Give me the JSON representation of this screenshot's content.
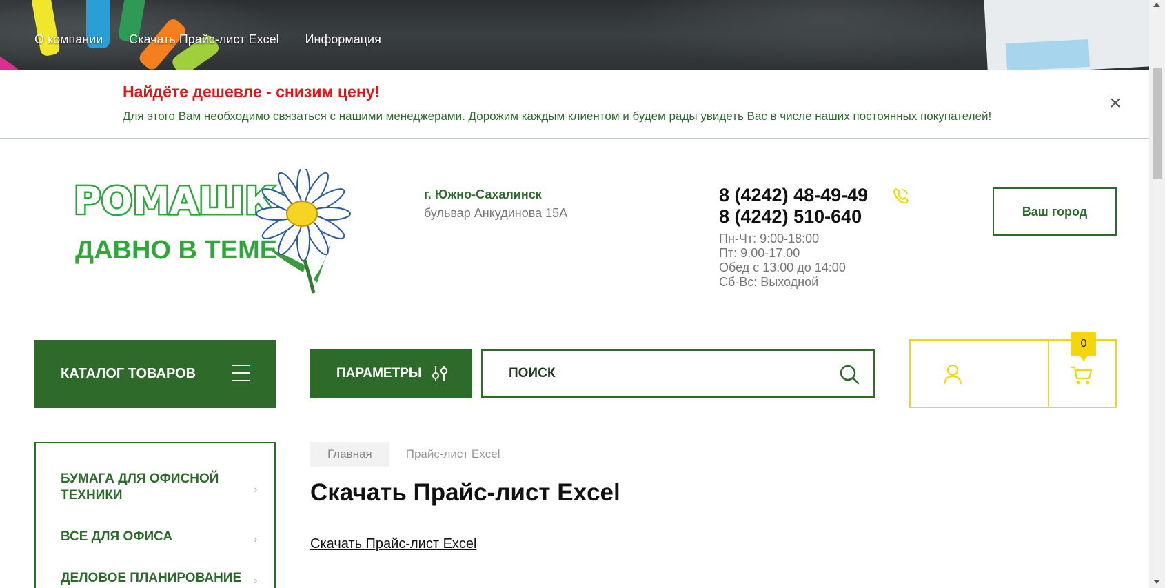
{
  "topnav": {
    "items": [
      {
        "label": "О компании"
      },
      {
        "label": "Скачать Прайс-лист Excel"
      },
      {
        "label": "Информация"
      }
    ]
  },
  "promo": {
    "title": "Найдёте дешевле - снизим цену!",
    "text": "Для этого Вам необходимо связаться с нашими менеджерами. Дорожим каждым клиентом и будем рады увидеть Вас в числе наших постоянных покупателей!",
    "close_symbol": "×"
  },
  "logo": {
    "name": "РОМАШКА",
    "slogan": "ДАВНО В ТЕМЕ!"
  },
  "address": {
    "city": "г. Южно-Сахалинск",
    "street": "бульвар Анкудинова 15А"
  },
  "contacts": {
    "phone1": "8 (4242) 48-49-49",
    "phone2": "8 (4242) 510-640",
    "hours": [
      "Пн-Чт: 9:00-18:00",
      "Пт: 9.00-17.00",
      "Обед с 13:00 до 14:00",
      "Сб-Вс: Выходной"
    ]
  },
  "city_button": {
    "label": "Ваш город"
  },
  "catalog_button": {
    "label": "КАТАЛОГ ТОВАРОВ"
  },
  "params_button": {
    "label": "ПАРАМЕТРЫ"
  },
  "search": {
    "placeholder": "ПОИСК"
  },
  "cart": {
    "count": "0"
  },
  "sidebar": {
    "items": [
      {
        "label": "БУМАГА ДЛЯ ОФИСНОЙ ТЕХНИКИ"
      },
      {
        "label": "ВСЕ ДЛЯ ОФИСА"
      },
      {
        "label": "ДЕЛОВОЕ ПЛАНИРОВАНИЕ"
      }
    ]
  },
  "breadcrumb": {
    "home": "Главная",
    "current": "Прайс-лист Excel"
  },
  "main": {
    "title": "Скачать Прайс-лист Excel",
    "download_link": "Скачать Прайс-лист Excel"
  },
  "colors": {
    "brand_green": "#2e6a2a",
    "accent_yellow": "#f5d60a",
    "promo_red": "#e51414"
  },
  "icons": [
    "menu-icon",
    "filter-icon",
    "search-icon",
    "user-icon",
    "cart-icon",
    "phone-icon",
    "close-icon",
    "chevron-right-icon"
  ]
}
